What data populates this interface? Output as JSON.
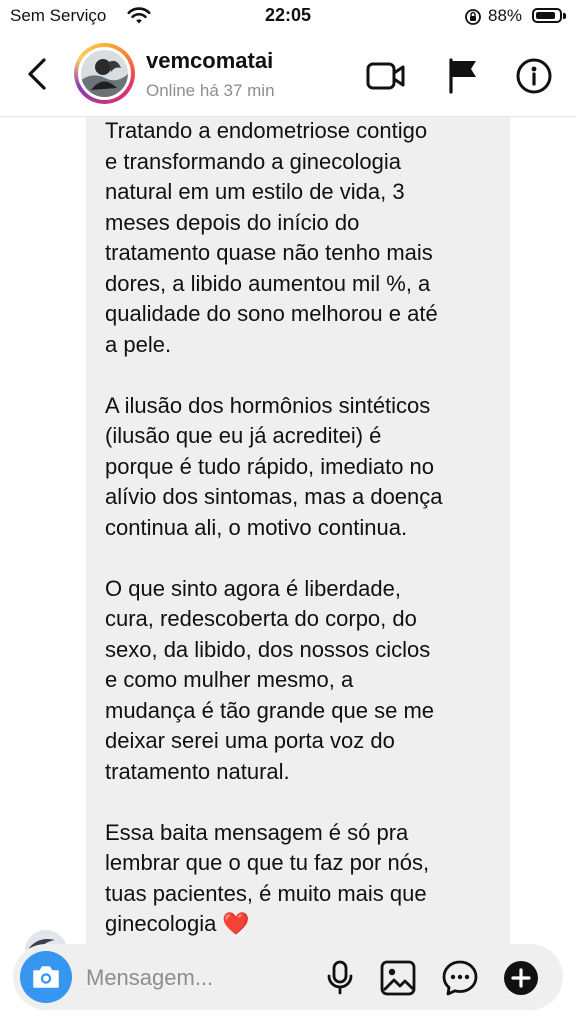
{
  "status_bar": {
    "carrier": "Sem Serviço",
    "time": "22:05",
    "battery_percent": "88%",
    "battery_level": 0.88
  },
  "header": {
    "username": "vemcomatai",
    "presence": "Online há 37 min",
    "icons": [
      "back-chevron-icon",
      "video-call-icon",
      "flag-icon",
      "info-icon"
    ]
  },
  "message": {
    "paragraphs": [
      {
        "lines": [
          "Tratando a endometriose contigo",
          "e transformando a ginecologia",
          "natural em um estilo de vida, 3",
          "meses depois do início do",
          "tratamento quase não tenho mais",
          "dores, a libido aumentou mil %, a",
          "qualidade do sono melhorou e até",
          "a pele."
        ]
      },
      {
        "lines": [
          "A ilusão dos hormônios sintéticos",
          "(ilusão que eu já acreditei) é",
          "porque é tudo rápido, imediato no",
          "alívio dos sintomas, mas a doença",
          "continua ali, o motivo continua."
        ]
      },
      {
        "lines": [
          "O que sinto agora é liberdade,",
          "cura, redescoberta do corpo, do",
          "sexo, da libido, dos nossos ciclos",
          "e como mulher mesmo, a",
          "mudança é tão grande que se me",
          "deixar serei uma porta voz do",
          "tratamento natural."
        ]
      },
      {
        "lines": [
          "Essa baita mensagem é só pra",
          "lembrar que o que tu faz por nós,",
          "tuas pacientes, é muito mais que",
          "ginecologia ❤️"
        ]
      }
    ]
  },
  "composer": {
    "placeholder": "Mensagem...",
    "icons": [
      "camera-icon",
      "microphone-icon",
      "gallery-icon",
      "sticker-icon",
      "plus-icon"
    ],
    "camera_color": "#3797f0"
  }
}
